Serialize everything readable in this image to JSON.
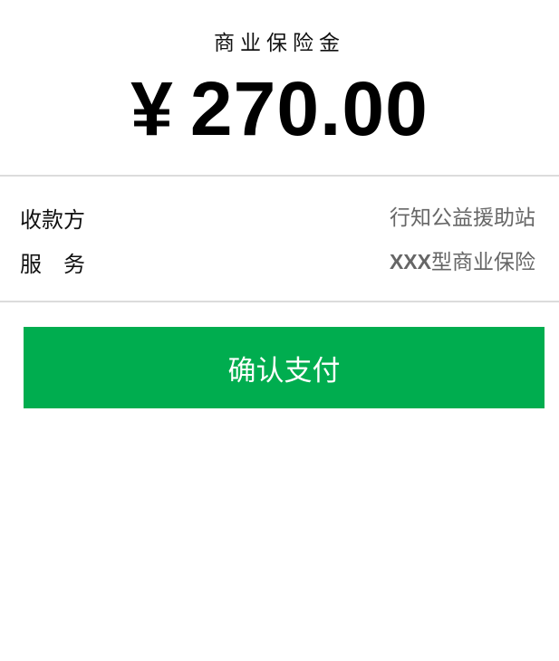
{
  "header": {
    "title": "商业保险金",
    "currency_symbol": "¥",
    "amount": "270.00"
  },
  "details": {
    "payee_label": "收款方",
    "payee_value": "行知公益援助站",
    "service_label": "服　务",
    "service_value_prefix": "XXX",
    "service_value_suffix": "型商业保险"
  },
  "actions": {
    "confirm_label": "确认支付"
  },
  "colors": {
    "button": "#00ad4f",
    "divider": "#dcdcdc",
    "value_text": "#666666"
  }
}
